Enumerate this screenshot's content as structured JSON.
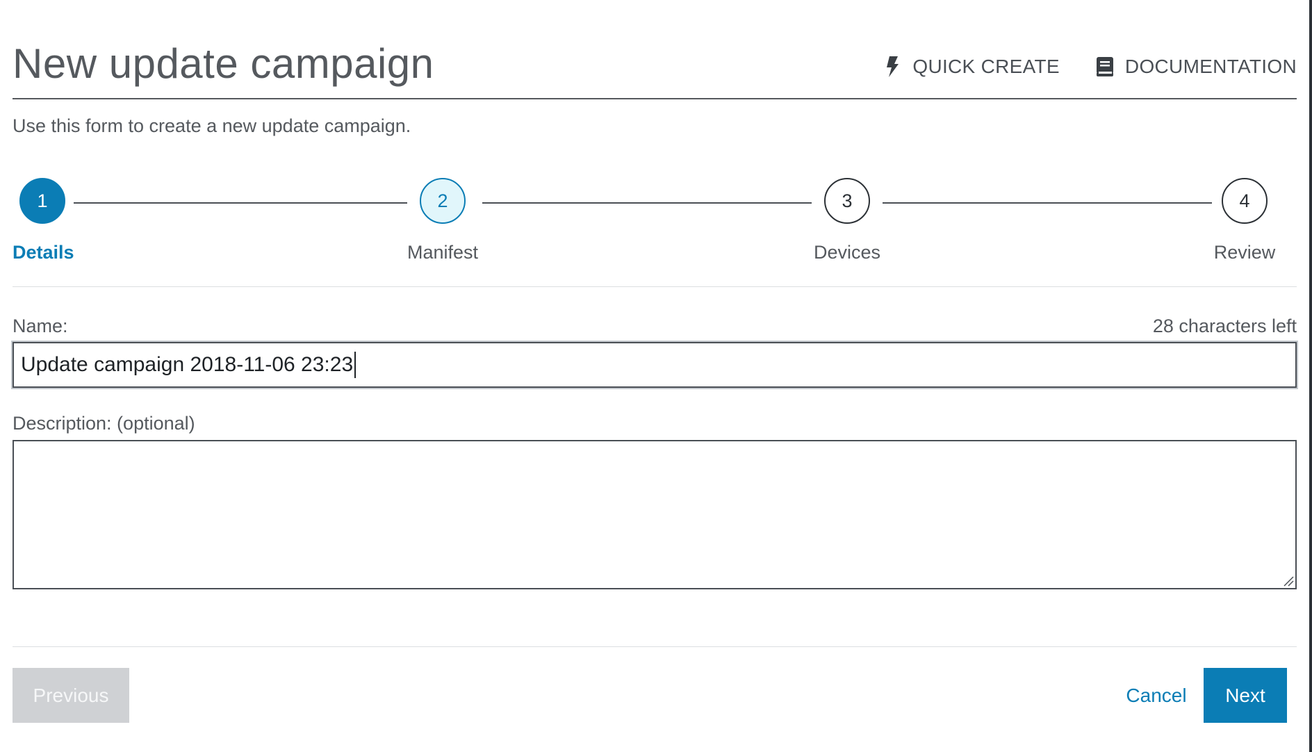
{
  "header": {
    "title": "New update campaign",
    "quick_create_label": "QUICK CREATE",
    "quick_create_icon": "lightning-icon",
    "documentation_label": "DOCUMENTATION",
    "documentation_icon": "book-icon"
  },
  "subtitle": "Use this form to create a new update campaign.",
  "stepper": {
    "current_step": 1,
    "steps": [
      {
        "number": "1",
        "label": "Details",
        "state": "active"
      },
      {
        "number": "2",
        "label": "Manifest",
        "state": "next"
      },
      {
        "number": "3",
        "label": "Devices",
        "state": "todo"
      },
      {
        "number": "4",
        "label": "Review",
        "state": "todo"
      }
    ]
  },
  "form": {
    "name_label": "Name:",
    "name_chars_left": "28 characters left",
    "name_value": "Update campaign 2018-11-06 23:23",
    "description_label": "Description: (optional)",
    "description_value": ""
  },
  "footer": {
    "previous_label": "Previous",
    "cancel_label": "Cancel",
    "next_label": "Next"
  },
  "colors": {
    "accent": "#0b7db5",
    "step_next_fill": "#e1f6fb",
    "disabled_button": "#cfd1d4",
    "text": "#4a4f55"
  }
}
